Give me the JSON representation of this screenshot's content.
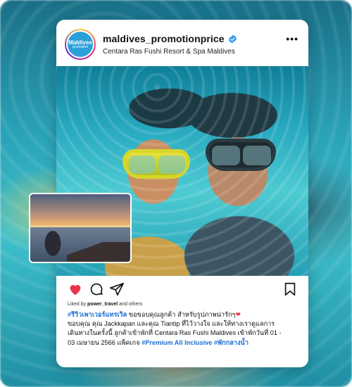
{
  "post": {
    "username": "maldives_promotionprice",
    "location": "Centara Ras Fushi Resort & Spa Maldives",
    "more_label": "•••",
    "avatar": {
      "line1": "Maldives",
      "line2": "promotion"
    },
    "liked_by_prefix": "Liked by ",
    "liked_by_user": "power_travel",
    "liked_by_suffix": " and others",
    "caption": {
      "line1_tag": "#รีวิวเพาเวอร์แทรเวิล",
      "line1_text": " ขอขอบคุณลูกค้า สำหรับรูปภาพน่ารักๆ",
      "line1_heart": "❤",
      "line2": "ขอบคุณ คุณ Jackkapan และคุณ Tiantip ที่ไว้วางใจ และให้ทางเราดูแลการ",
      "line3": "เดินทางในครั้งนี้ ลูกค้าเข้าพักที่ Centara Ras Fushi Maldives เข้าพักวันที่ 01 -",
      "line4_text": "03 เมษายน 2566 แพ็คเกจ ",
      "line4_tag1": "#Premium All Inclusive",
      "line4_space": " ",
      "line4_tag2": "#พักกลางน้ำ"
    }
  },
  "colors": {
    "like": "#e8334a",
    "hashtag": "#1f6fd1",
    "verified": "#3897f0"
  },
  "icons": [
    "heart-icon",
    "comment-icon",
    "share-icon",
    "bookmark-icon",
    "verified-badge-icon",
    "more-options-icon"
  ]
}
